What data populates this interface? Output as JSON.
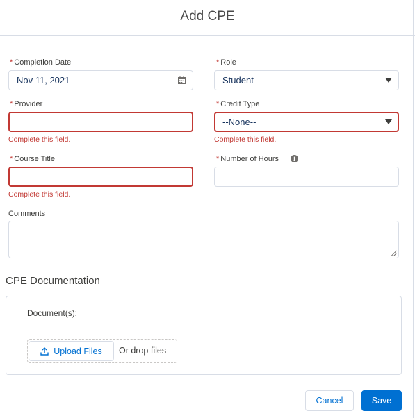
{
  "modal": {
    "title": "Add CPE"
  },
  "fields": {
    "completion_date": {
      "label": "Completion Date",
      "value": "Nov 11, 2021",
      "required": true
    },
    "role": {
      "label": "Role",
      "value": "Student",
      "required": true
    },
    "provider": {
      "label": "Provider",
      "value": "",
      "error": "Complete this field.",
      "required": true
    },
    "credit_type": {
      "label": "Credit Type",
      "value": "--None--",
      "error": "Complete this field.",
      "required": true
    },
    "course_title": {
      "label": "Course Title",
      "value": "",
      "error": "Complete this field.",
      "required": true
    },
    "number_of_hours": {
      "label": "Number of Hours",
      "value": "",
      "required": true
    },
    "comments": {
      "label": "Comments",
      "value": ""
    }
  },
  "documentation": {
    "title": "CPE Documentation",
    "label": "Document(s):",
    "upload_label": "Upload Files",
    "drop_text": "Or drop files"
  },
  "footer": {
    "cancel_label": "Cancel",
    "save_label": "Save"
  },
  "required_marker": "*",
  "colors": {
    "error": "#c23934",
    "brand": "#0070d2",
    "border": "#d8dde6"
  },
  "icons": {
    "date": "calendar-icon",
    "select": "chevron-down-icon",
    "help": "info-icon",
    "upload": "upload-icon"
  }
}
